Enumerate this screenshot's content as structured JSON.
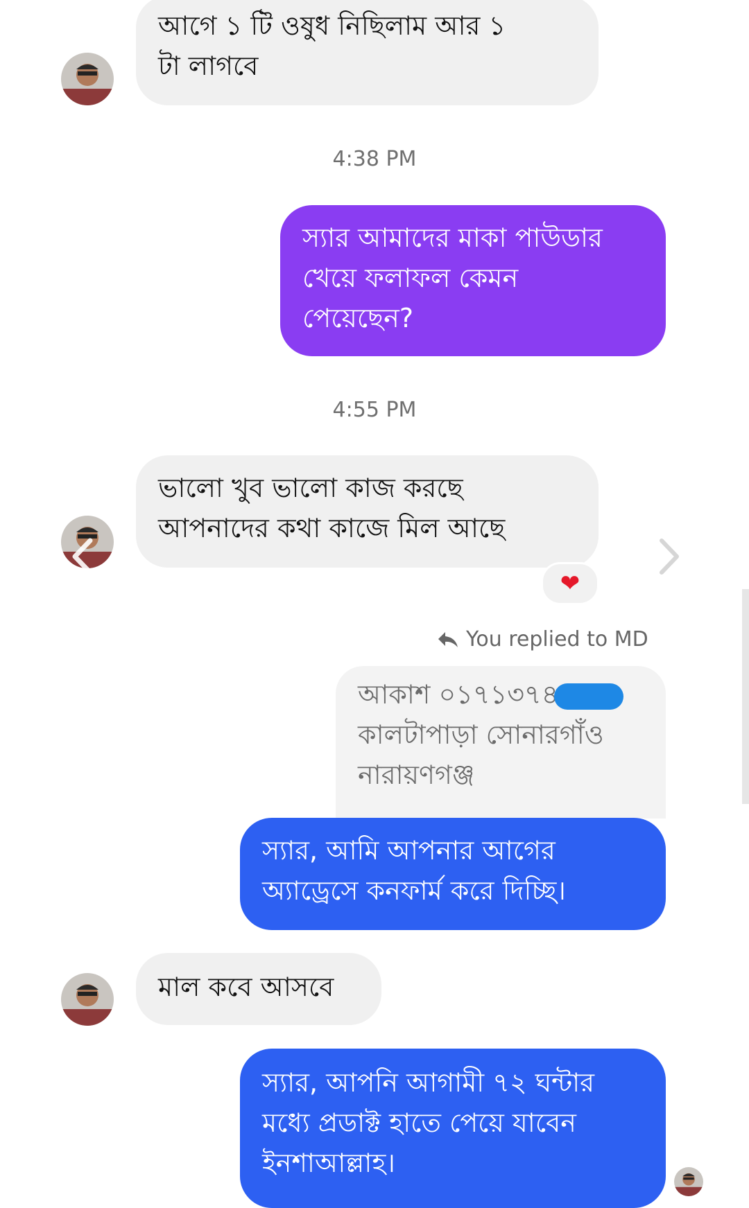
{
  "conversation": {
    "messages": [
      {
        "side": "in",
        "text": "আগে ১ টি ওষুধ নিছিলাম  আর ১\nটা লাগবে"
      },
      {
        "side": "out",
        "text": "স্যার আমাদের মাকা পাউডার\nখেয়ে ফলাফল কেমন\nপেয়েছেন?"
      },
      {
        "side": "in",
        "text": "ভালো খুব ভালো কাজ করছে\nআপনাদের কথা কাজে মিল আছে"
      },
      {
        "side": "quoted",
        "line1": "আকাশ ০১৭১৩৭৪",
        "line2": "কালটাপাড়া সোনারগাঁও",
        "line3": "নারায়ণগঞ্জ"
      },
      {
        "side": "out",
        "text": "স্যার, আমি আপনার আগের\nঅ্যাড্রেসে কনফার্ম করে দিচ্ছি।"
      },
      {
        "side": "in",
        "text": "মাল কবে আসবে"
      },
      {
        "side": "out",
        "text": "স্যার, আপনি আগামী ৭২ ঘন্টার\nমধ্যে প্রডাক্ট হাতে পেয়ে যাবেন\nইনশাআল্লাহ।"
      }
    ],
    "timestamps": [
      "4:38 PM",
      "4:55 PM"
    ],
    "reply_meta": "You replied to MD",
    "reaction": {
      "emoji": "❤"
    },
    "colors": {
      "incoming_bubble": "#f0f0f0",
      "outgoing_purple": "#8a3df2",
      "outgoing_blue": "#2d60f2",
      "reaction": "#e5182a"
    },
    "icons": [
      "avatar",
      "reply-arrow-icon",
      "heart-icon",
      "chevron-left-icon",
      "chevron-right-icon"
    ]
  }
}
